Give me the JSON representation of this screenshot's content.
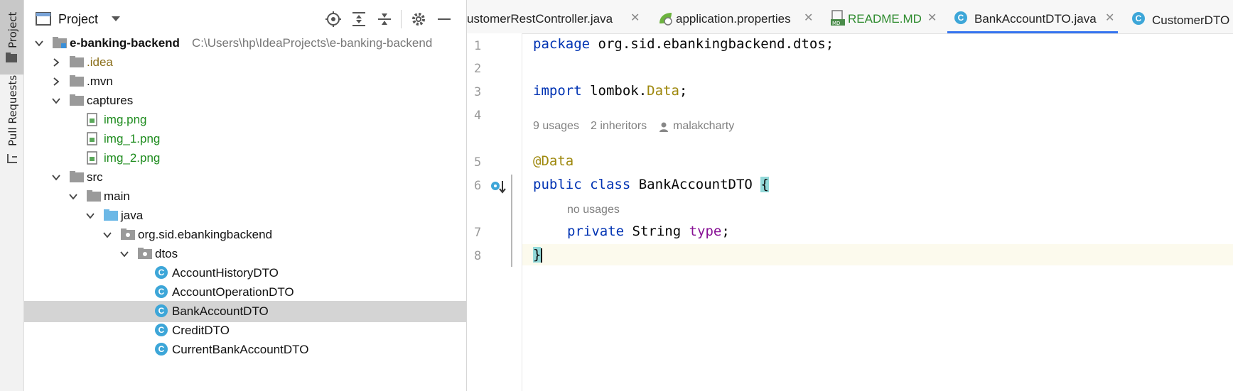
{
  "side_strip": {
    "project_tab": "Project",
    "pull_requests_tab": "Pull Requests"
  },
  "project_panel": {
    "title": "Project",
    "tree": [
      {
        "label": "e-banking-backend",
        "path": "C:\\Users\\hp\\IdeaProjects\\e-banking-backend",
        "color": "#111111"
      },
      {
        "label": ".idea",
        "color": "#8a6e1a"
      },
      {
        "label": ".mvn",
        "color": "#111111"
      },
      {
        "label": "captures",
        "color": "#111111"
      },
      {
        "label": "img.png",
        "color": "#1e8c1e"
      },
      {
        "label": "img_1.png",
        "color": "#1e8c1e"
      },
      {
        "label": "img_2.png",
        "color": "#1e8c1e"
      },
      {
        "label": "src",
        "color": "#111111"
      },
      {
        "label": "main",
        "color": "#111111"
      },
      {
        "label": "java",
        "color": "#111111"
      },
      {
        "label": "org.sid.ebankingbackend",
        "color": "#111111"
      },
      {
        "label": "dtos",
        "color": "#111111"
      },
      {
        "label": "AccountHistoryDTO",
        "color": "#111111"
      },
      {
        "label": "AccountOperationDTO",
        "color": "#111111"
      },
      {
        "label": "BankAccountDTO",
        "color": "#111111"
      },
      {
        "label": "CreditDTO",
        "color": "#111111"
      },
      {
        "label": "CurrentBankAccountDTO",
        "color": "#111111"
      }
    ]
  },
  "editor": {
    "tabs": [
      {
        "label": "ustomerRestController.java"
      },
      {
        "label": "application.properties"
      },
      {
        "label": "README.MD"
      },
      {
        "label": "BankAccountDTO.java"
      },
      {
        "label": "CustomerDTO"
      }
    ],
    "line_numbers": [
      "1",
      "2",
      "3",
      "4",
      "5",
      "6",
      "7",
      "8"
    ],
    "code": {
      "l1_kw": "package",
      "l1_rest": " org.sid.ebankingbackend.dtos;",
      "l3_kw": "import",
      "l3_mid": " lombok.",
      "l3_ann": "Data",
      "l3_end": ";",
      "l5_ann": "@Data",
      "l6_kw": "public class",
      "l6_name": " BankAccountDTO ",
      "l6_brace": "{",
      "l7_kw": "private",
      "l7_type": " String ",
      "l7_field": "type",
      "l7_end": ";",
      "l8_brace": "}"
    },
    "hints": {
      "usages": "9 usages",
      "inheritors": "2 inheritors",
      "author": "malakcharty",
      "no_usages": "no usages"
    }
  }
}
